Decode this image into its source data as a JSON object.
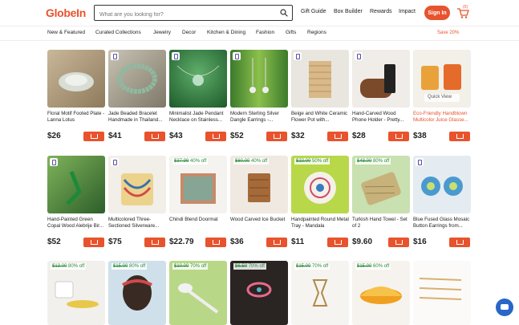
{
  "header": {
    "logo": "GlobeIn",
    "search_placeholder": "What are you looking for?",
    "links": [
      "Gift Guide",
      "Box Builder",
      "Rewards",
      "Impact"
    ],
    "signin": "Sign In",
    "cart_count": "(0)"
  },
  "categories": [
    "New & Featured",
    "Curated Collections",
    "Jewelry",
    "Decor",
    "Kitchen & Dining",
    "Fashion",
    "Gifts",
    "Regions"
  ],
  "promo": "Save 20%",
  "row1": [
    {
      "name": "Floral Motif Footed Plate - Lanna Lotus",
      "price": "$26"
    },
    {
      "name": "Jade Beaded Bracelet Handmade in Thailand...",
      "price": "$41"
    },
    {
      "name": "Minimalist Jade Pendant Necklace on Stainless...",
      "price": "$43"
    },
    {
      "name": "Modern Sterling Silver Dangle Earrings -...",
      "price": "$52"
    },
    {
      "name": "Beige and White Ceramic Flower Pot with...",
      "price": "$32"
    },
    {
      "name": "Hand-Carved Wood Phone Holder - Pretty...",
      "price": "$28"
    },
    {
      "name": "Eco-Friendly Handblown Multicolor Juice Glasse...",
      "price": "$38",
      "overlay": "Quick View"
    }
  ],
  "row2": [
    {
      "name": "Hand-Painted Green Copal Wood Alebrije Bir...",
      "price": "$52"
    },
    {
      "name": "Multicolored Three-Sectioned Silverware...",
      "price": "$75"
    },
    {
      "name": "Chindi Blend Doormat",
      "price": "$22.79",
      "old": "$37.99",
      "off": "40% off"
    },
    {
      "name": "Wood Carved Ice Bucket",
      "price": "$36",
      "old": "$60.00",
      "off": "40% off"
    },
    {
      "name": "Handpainted Round Metal Tray - Mandala",
      "price": "$11",
      "old": "$22.00",
      "off": "50% off"
    },
    {
      "name": "Turkish Hand Towel - Set of 2",
      "price": "$9.60",
      "old": "$48.00",
      "off": "80% off"
    },
    {
      "name": "Blue Fused Glass Mosaic Button Earrings from...",
      "price": "$16"
    }
  ],
  "row3": [
    {
      "old": "$13.00",
      "off": "80% off"
    },
    {
      "old": "$15.00",
      "off": "80% off"
    },
    {
      "old": "$10.00",
      "off": "70% off"
    },
    {
      "old": "$6.50",
      "off": "70% off"
    },
    {
      "old": "$15.00",
      "off": "70% off"
    },
    {
      "old": "$15.00",
      "off": "60% off"
    },
    {}
  ]
}
